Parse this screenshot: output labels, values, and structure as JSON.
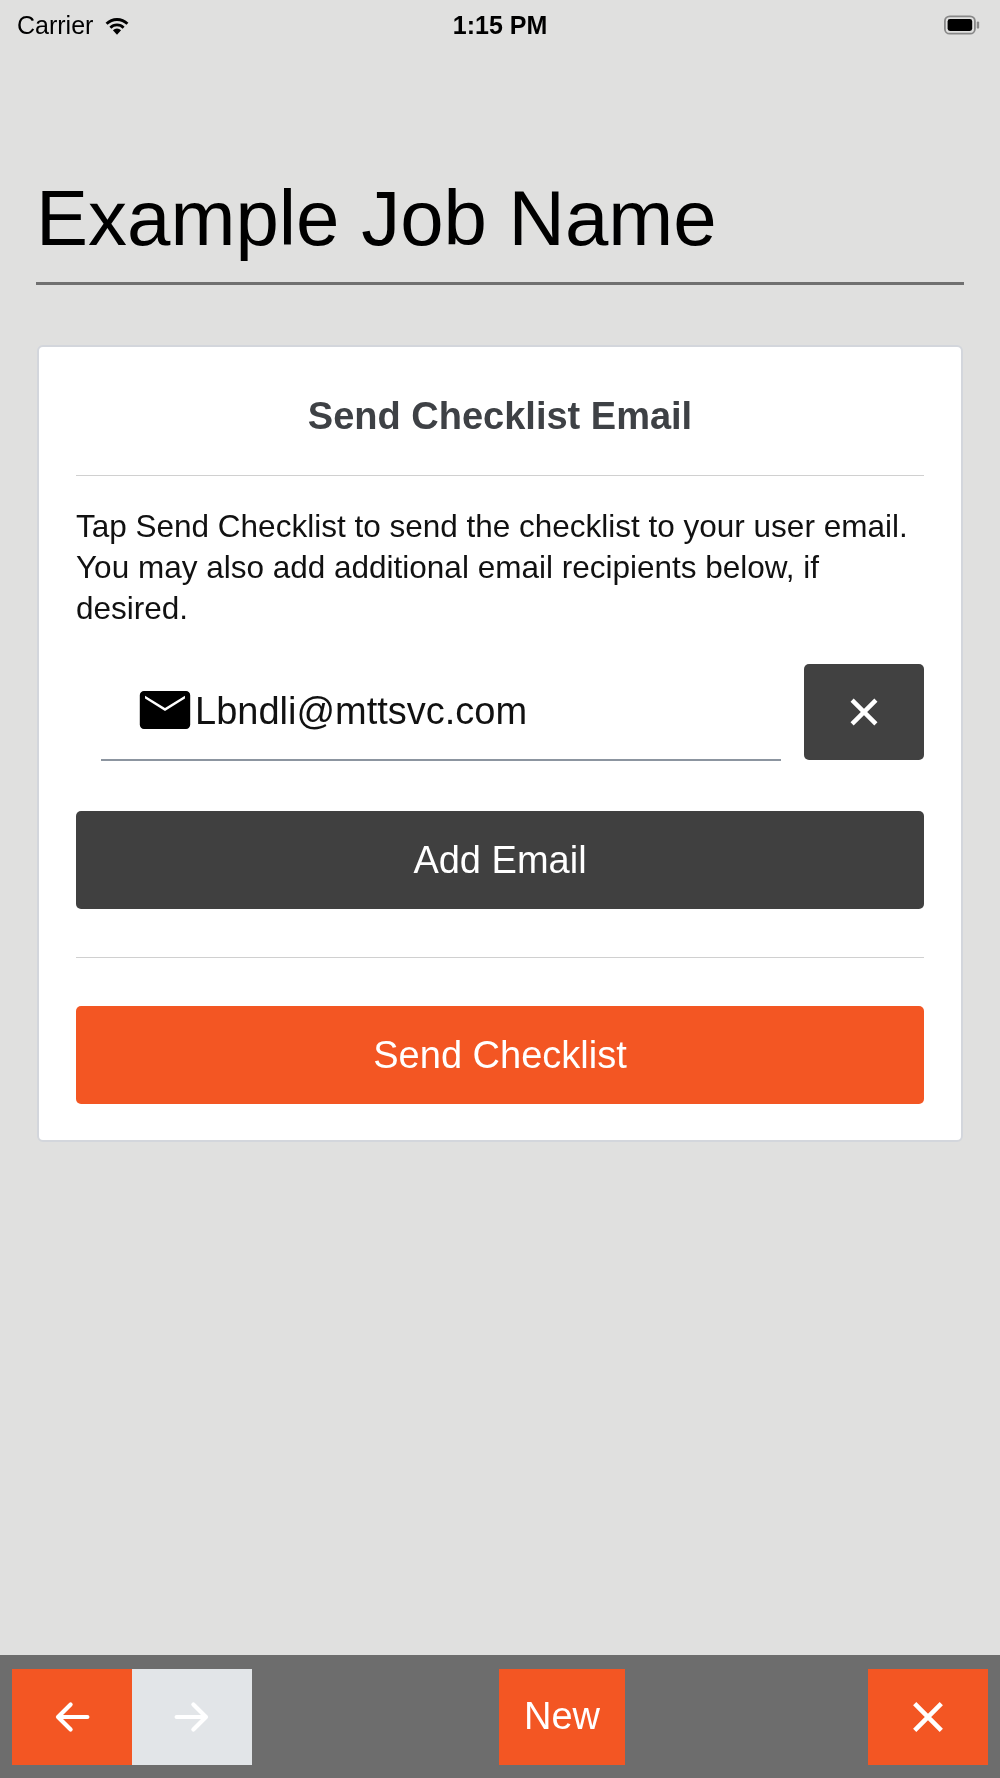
{
  "status_bar": {
    "carrier": "Carrier",
    "time": "1:15 PM"
  },
  "title": "Example Job Name",
  "card": {
    "heading": "Send Checklist Email",
    "description": "Tap Send Checklist to send the checklist to your user email. You may also add additional email recipients below, if desired.",
    "recipients": [
      {
        "value": "Lbndli@mttsvc.com"
      }
    ],
    "add_button": "Add Email",
    "send_button": "Send Checklist"
  },
  "toolbar": [
    {
      "kind": "back",
      "disabled": false
    },
    {
      "kind": "forward",
      "disabled": true
    },
    {
      "kind": "new",
      "label": "New",
      "disabled": false
    },
    {
      "kind": "close",
      "disabled": false
    }
  ]
}
